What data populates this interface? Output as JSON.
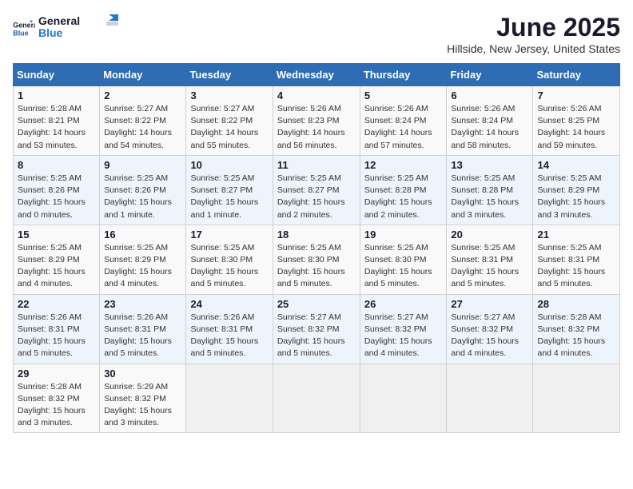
{
  "header": {
    "logo": {
      "general": "General",
      "blue": "Blue"
    },
    "title": "June 2025",
    "location": "Hillside, New Jersey, United States"
  },
  "calendar": {
    "days_of_week": [
      "Sunday",
      "Monday",
      "Tuesday",
      "Wednesday",
      "Thursday",
      "Friday",
      "Saturday"
    ],
    "weeks": [
      [
        {
          "day": "1",
          "sunrise": "5:28 AM",
          "sunset": "8:21 PM",
          "daylight": "14 hours and 53 minutes."
        },
        {
          "day": "2",
          "sunrise": "5:27 AM",
          "sunset": "8:22 PM",
          "daylight": "14 hours and 54 minutes."
        },
        {
          "day": "3",
          "sunrise": "5:27 AM",
          "sunset": "8:22 PM",
          "daylight": "14 hours and 55 minutes."
        },
        {
          "day": "4",
          "sunrise": "5:26 AM",
          "sunset": "8:23 PM",
          "daylight": "14 hours and 56 minutes."
        },
        {
          "day": "5",
          "sunrise": "5:26 AM",
          "sunset": "8:24 PM",
          "daylight": "14 hours and 57 minutes."
        },
        {
          "day": "6",
          "sunrise": "5:26 AM",
          "sunset": "8:24 PM",
          "daylight": "14 hours and 58 minutes."
        },
        {
          "day": "7",
          "sunrise": "5:26 AM",
          "sunset": "8:25 PM",
          "daylight": "14 hours and 59 minutes."
        }
      ],
      [
        {
          "day": "8",
          "sunrise": "5:25 AM",
          "sunset": "8:26 PM",
          "daylight": "15 hours and 0 minutes."
        },
        {
          "day": "9",
          "sunrise": "5:25 AM",
          "sunset": "8:26 PM",
          "daylight": "15 hours and 1 minute."
        },
        {
          "day": "10",
          "sunrise": "5:25 AM",
          "sunset": "8:27 PM",
          "daylight": "15 hours and 1 minute."
        },
        {
          "day": "11",
          "sunrise": "5:25 AM",
          "sunset": "8:27 PM",
          "daylight": "15 hours and 2 minutes."
        },
        {
          "day": "12",
          "sunrise": "5:25 AM",
          "sunset": "8:28 PM",
          "daylight": "15 hours and 2 minutes."
        },
        {
          "day": "13",
          "sunrise": "5:25 AM",
          "sunset": "8:28 PM",
          "daylight": "15 hours and 3 minutes."
        },
        {
          "day": "14",
          "sunrise": "5:25 AM",
          "sunset": "8:29 PM",
          "daylight": "15 hours and 3 minutes."
        }
      ],
      [
        {
          "day": "15",
          "sunrise": "5:25 AM",
          "sunset": "8:29 PM",
          "daylight": "15 hours and 4 minutes."
        },
        {
          "day": "16",
          "sunrise": "5:25 AM",
          "sunset": "8:29 PM",
          "daylight": "15 hours and 4 minutes."
        },
        {
          "day": "17",
          "sunrise": "5:25 AM",
          "sunset": "8:30 PM",
          "daylight": "15 hours and 5 minutes."
        },
        {
          "day": "18",
          "sunrise": "5:25 AM",
          "sunset": "8:30 PM",
          "daylight": "15 hours and 5 minutes."
        },
        {
          "day": "19",
          "sunrise": "5:25 AM",
          "sunset": "8:30 PM",
          "daylight": "15 hours and 5 minutes."
        },
        {
          "day": "20",
          "sunrise": "5:25 AM",
          "sunset": "8:31 PM",
          "daylight": "15 hours and 5 minutes."
        },
        {
          "day": "21",
          "sunrise": "5:25 AM",
          "sunset": "8:31 PM",
          "daylight": "15 hours and 5 minutes."
        }
      ],
      [
        {
          "day": "22",
          "sunrise": "5:26 AM",
          "sunset": "8:31 PM",
          "daylight": "15 hours and 5 minutes."
        },
        {
          "day": "23",
          "sunrise": "5:26 AM",
          "sunset": "8:31 PM",
          "daylight": "15 hours and 5 minutes."
        },
        {
          "day": "24",
          "sunrise": "5:26 AM",
          "sunset": "8:31 PM",
          "daylight": "15 hours and 5 minutes."
        },
        {
          "day": "25",
          "sunrise": "5:27 AM",
          "sunset": "8:32 PM",
          "daylight": "15 hours and 5 minutes."
        },
        {
          "day": "26",
          "sunrise": "5:27 AM",
          "sunset": "8:32 PM",
          "daylight": "15 hours and 4 minutes."
        },
        {
          "day": "27",
          "sunrise": "5:27 AM",
          "sunset": "8:32 PM",
          "daylight": "15 hours and 4 minutes."
        },
        {
          "day": "28",
          "sunrise": "5:28 AM",
          "sunset": "8:32 PM",
          "daylight": "15 hours and 4 minutes."
        }
      ],
      [
        {
          "day": "29",
          "sunrise": "5:28 AM",
          "sunset": "8:32 PM",
          "daylight": "15 hours and 3 minutes."
        },
        {
          "day": "30",
          "sunrise": "5:29 AM",
          "sunset": "8:32 PM",
          "daylight": "15 hours and 3 minutes."
        },
        null,
        null,
        null,
        null,
        null
      ]
    ]
  }
}
